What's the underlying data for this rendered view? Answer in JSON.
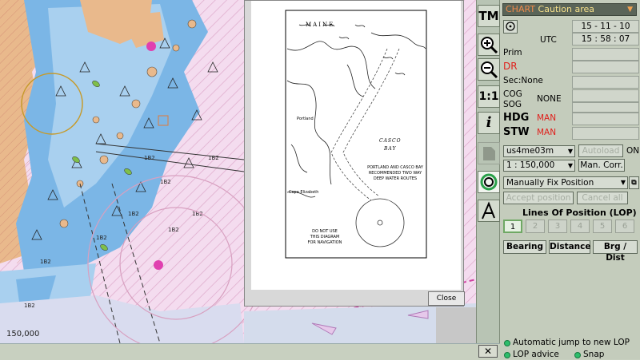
{
  "chart": {
    "scale_label": "150,000"
  },
  "popup": {
    "region_label": "MAINE",
    "bay_label_1": "CASCO",
    "bay_label_2": "BAY",
    "route_note_1": "PORTLAND AND CASCO BAY",
    "route_note_2": "RECOMMENDED TWO WAY",
    "route_note_3": "DEEP WATER ROUTES",
    "place_portland": "Portland",
    "place_cape": "Cape Elizabeth",
    "warn_1": "DO NOT USE",
    "warn_2": "THIS DIAGRAM",
    "warn_3": "FOR NAVIGATION",
    "close_label": "Close"
  },
  "toolbar": {
    "tm_label": "TM",
    "scale_label": "1:1",
    "info_label": "i"
  },
  "panel": {
    "chart_prefix": "CHART",
    "chart_value": "Caution area",
    "date": "15 - 11 - 10",
    "tz_label": "UTC",
    "time": "15 : 58 : 07",
    "prim_label": "Prim",
    "dr_label": "DR",
    "sec_label": "Sec:None",
    "cog_label": "COG",
    "sog_label": "SOG",
    "cogsog_value": "NONE",
    "hdg_label": "HDG",
    "hdg_value": "MAN",
    "stw_label": "STW",
    "stw_value": "MAN",
    "chart_name": "us4me03m",
    "autoload_label": "Autoload",
    "on_label": "ON",
    "scale_value": "1 : 150,000",
    "mancorr_label": "Man. Corr.",
    "fix_mode": "Manually Fix Position",
    "accept_label": "Accept position",
    "cancel_label": "Cancel all",
    "lop_title": "Lines Of Position (LOP)",
    "lop_numbers": [
      "1",
      "2",
      "3",
      "4",
      "5",
      "6"
    ],
    "bearing_label": "Bearing",
    "distance_label": "Distance",
    "brgdist_label": "Brg / Dist",
    "auto_jump_label": "Automatic jump to new LOP",
    "lop_advice_label": "LOP advice",
    "snap_label": "Snap"
  }
}
